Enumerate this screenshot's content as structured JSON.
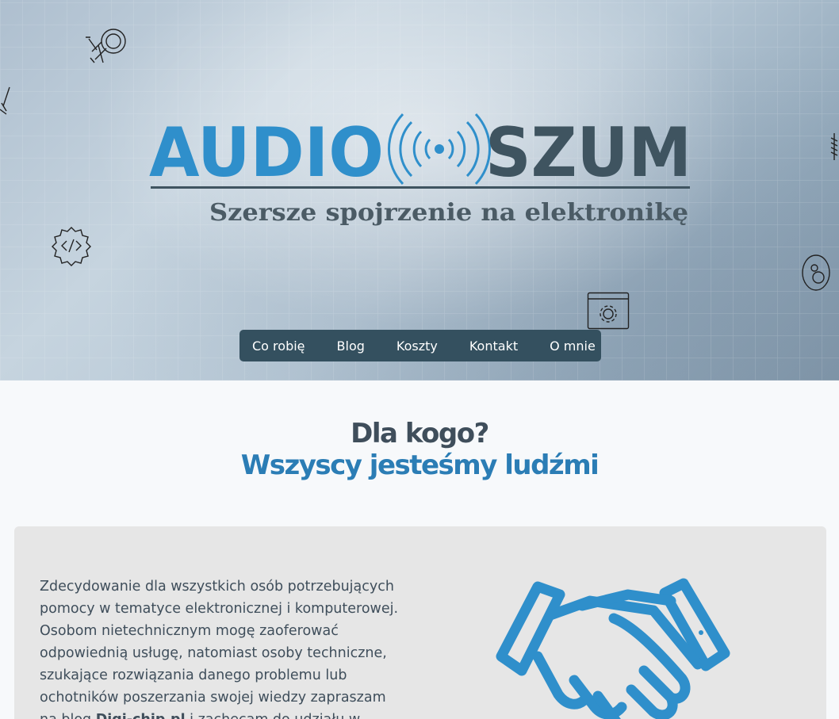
{
  "hero": {
    "logo": {
      "word_left": "AUDIO",
      "word_right": "SZUM",
      "tagline": "Szersze spojrzenie na elektronikę"
    }
  },
  "nav": {
    "items": [
      {
        "label": "Co robię"
      },
      {
        "label": "Blog"
      },
      {
        "label": "Koszty"
      },
      {
        "label": "Kontakt"
      },
      {
        "label": "O mnie"
      }
    ]
  },
  "section": {
    "title": "Dla kogo?",
    "subtitle": "Wszyscy jesteśmy ludźmi"
  },
  "card": {
    "text_before_link": "Zdecydowanie dla wszystkich osób potrzebujących pomocy w tematyce elektronicznej i komputerowej. Osobom nietechnicznym mogę zaoferować odpowiednią usługę, natomiast osoby techniczne, szukające rozwiązania danego problemu lub ochotników poszerzania swojej wiedzy zapraszam na blog ",
    "link_text": "Digi-chip.pl",
    "text_after_link": " i zachęcam do udziału w dyskusjach."
  },
  "colors": {
    "nav_bg": "#34505f",
    "accent_blue": "#2b7db5",
    "heading_dark": "#3f4e5b",
    "card_bg": "#e6e6e6"
  },
  "icons": {
    "hero_decorations": [
      "satellite-dish-icon",
      "code-gear-icon",
      "settings-window-icon",
      "pendant-icon",
      "guitar-icon",
      "screw-icon"
    ],
    "card": "handshake-icon"
  }
}
